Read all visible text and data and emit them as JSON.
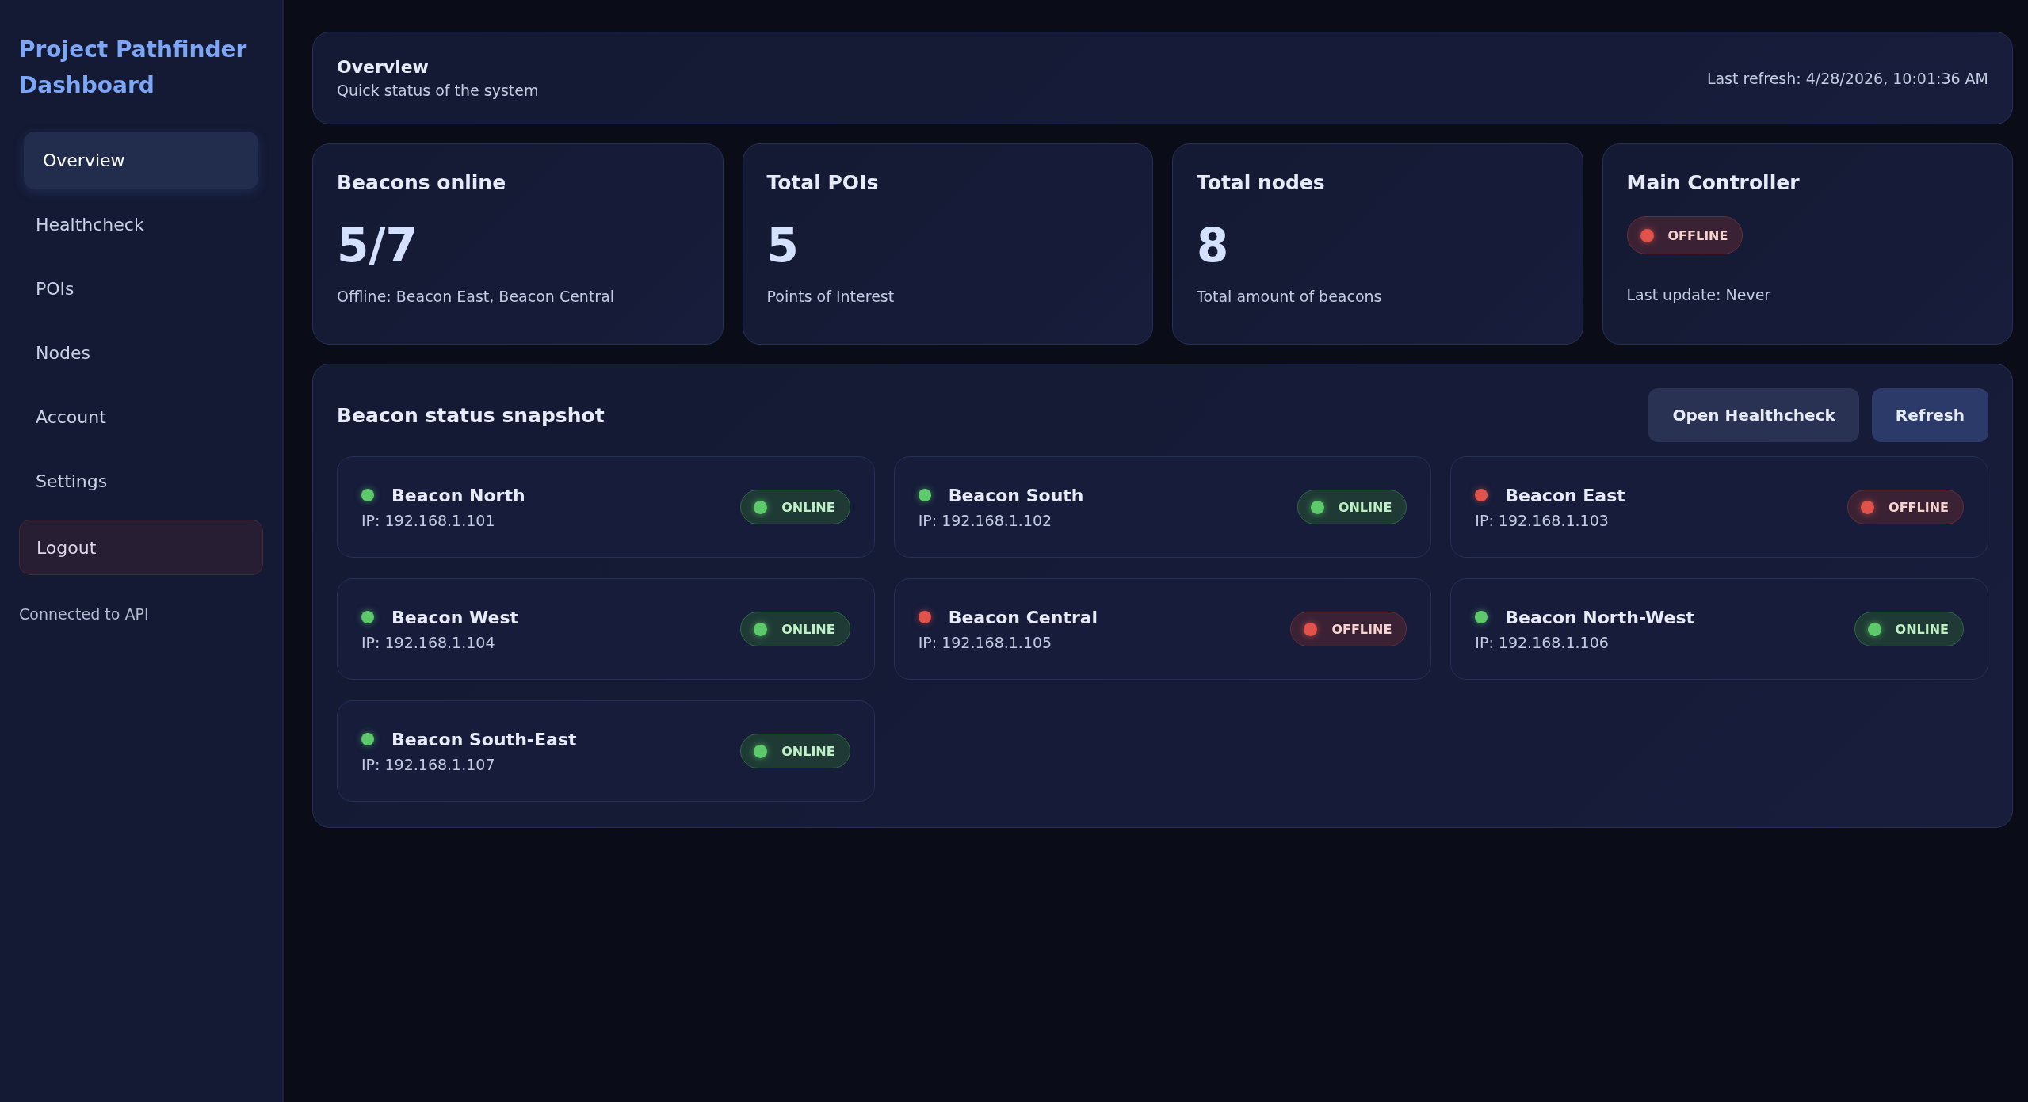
{
  "sidebar": {
    "title": "Project Pathfinder Dashboard",
    "items": [
      {
        "label": "Overview",
        "selected": true
      },
      {
        "label": "Healthcheck",
        "selected": false
      },
      {
        "label": "POIs",
        "selected": false
      },
      {
        "label": "Nodes",
        "selected": false
      },
      {
        "label": "Account",
        "selected": false
      },
      {
        "label": "Settings",
        "selected": false
      }
    ],
    "logout": "Logout",
    "connection": "Connected to API"
  },
  "header": {
    "title": "Overview",
    "subtitle": "Quick status of the system",
    "last_refresh": "Last refresh: 4/28/2026, 10:01:36 AM"
  },
  "stats": [
    {
      "kind": "number",
      "title": "Beacons online",
      "value": "5/7",
      "note": "Offline: Beacon East, Beacon Central"
    },
    {
      "kind": "number",
      "title": "Total POIs",
      "value": "5",
      "note": "Points of Interest"
    },
    {
      "kind": "number",
      "title": "Total nodes",
      "value": "8",
      "note": "Total amount of beacons"
    },
    {
      "kind": "status",
      "title": "Main Controller",
      "online": false,
      "badge": "OFFLINE",
      "note": "Last update: Never"
    }
  ],
  "snapshot": {
    "title": "Beacon status snapshot",
    "buttons": [
      "Open Healthcheck",
      "Refresh"
    ],
    "beacons": [
      {
        "name": "Beacon North",
        "ip": "IP: 192.168.1.101",
        "online": true,
        "badge": "ONLINE"
      },
      {
        "name": "Beacon South",
        "ip": "IP: 192.168.1.102",
        "online": true,
        "badge": "ONLINE"
      },
      {
        "name": "Beacon East",
        "ip": "IP: 192.168.1.103",
        "online": false,
        "badge": "OFFLINE"
      },
      {
        "name": "Beacon West",
        "ip": "IP: 192.168.1.104",
        "online": true,
        "badge": "ONLINE"
      },
      {
        "name": "Beacon Central",
        "ip": "IP: 192.168.1.105",
        "online": false,
        "badge": "OFFLINE"
      },
      {
        "name": "Beacon North-West",
        "ip": "IP: 192.168.1.106",
        "online": true,
        "badge": "ONLINE"
      },
      {
        "name": "Beacon South-East",
        "ip": "IP: 192.168.1.107",
        "online": true,
        "badge": "ONLINE"
      }
    ]
  }
}
